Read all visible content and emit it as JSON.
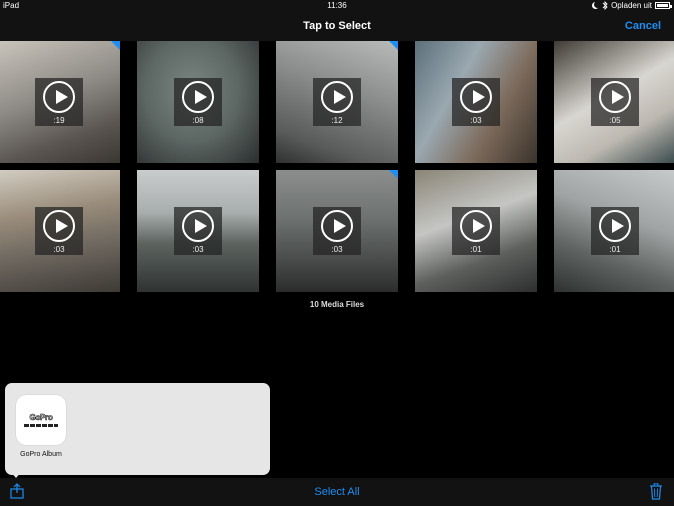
{
  "status_bar": {
    "device": "iPad",
    "time": "11:36",
    "charging_text": "Opladen uit",
    "icons": [
      "moon-icon",
      "bluetooth-icon",
      "battery-icon"
    ]
  },
  "nav": {
    "title": "Tap to Select",
    "cancel_label": "Cancel"
  },
  "grid": {
    "videos": [
      {
        "duration": ":19",
        "selected": true
      },
      {
        "duration": ":08",
        "selected": false
      },
      {
        "duration": ":12",
        "selected": true
      },
      {
        "duration": ":03",
        "selected": false
      },
      {
        "duration": ":05",
        "selected": false
      },
      {
        "duration": ":03",
        "selected": false
      },
      {
        "duration": ":03",
        "selected": false
      },
      {
        "duration": ":03",
        "selected": true
      },
      {
        "duration": ":01",
        "selected": false
      },
      {
        "duration": ":01",
        "selected": false
      }
    ]
  },
  "media_count": "10 Media Files",
  "share_sheet": {
    "app_name": "GoPro Album",
    "logo_text": "GoPro"
  },
  "toolbar": {
    "select_all_label": "Select All"
  },
  "colors": {
    "accent": "#1d8ef2",
    "bar_background": "#121212",
    "popover_background": "#e6e6e6"
  }
}
